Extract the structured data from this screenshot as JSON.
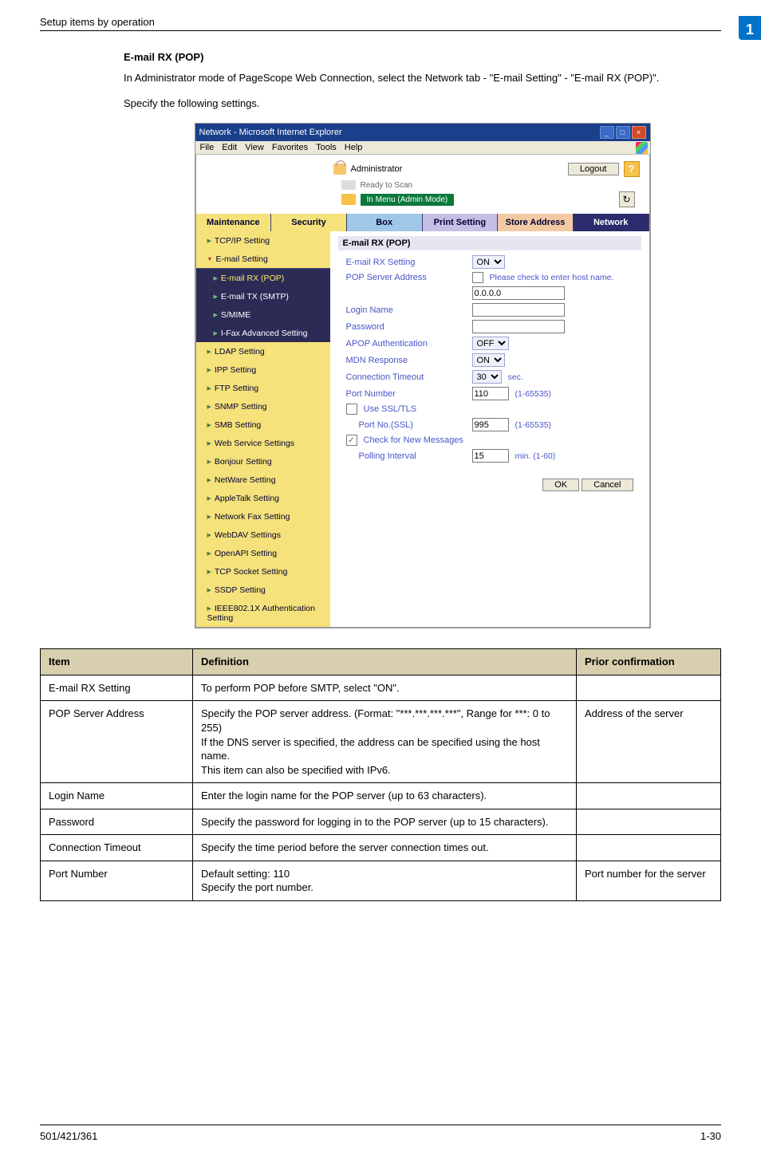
{
  "header": {
    "left": "Setup items by operation",
    "badge": "1"
  },
  "intro": {
    "title": "E-mail RX (POP)",
    "p1": "In Administrator mode of PageScope Web Connection, select the Network tab - \"E-mail Setting\" - \"E-mail RX (POP)\".",
    "p2": "Specify the following settings."
  },
  "window": {
    "title": "Network - Microsoft Internet Explorer",
    "menus": [
      "File",
      "Edit",
      "View",
      "Favorites",
      "Tools",
      "Help"
    ],
    "admin": "Administrator",
    "logout": "Logout",
    "status": "Ready to Scan",
    "mode": "In Menu (Admin Mode)",
    "tabs": {
      "maintenance": "Maintenance",
      "security": "Security",
      "box": "Box",
      "print": "Print Setting",
      "store": "Store Address",
      "network": "Network"
    }
  },
  "sidebar": {
    "tcpip": "TCP/IP Setting",
    "email": "E-mail Setting",
    "emailrx": "E-mail RX (POP)",
    "emailtx": "E-mail TX (SMTP)",
    "smime": "S/MIME",
    "ifax": "I-Fax Advanced Setting",
    "ldap": "LDAP Setting",
    "ipp": "IPP Setting",
    "ftp": "FTP Setting",
    "snmp": "SNMP Setting",
    "smb": "SMB Setting",
    "web": "Web Service Settings",
    "bonjour": "Bonjour Setting",
    "netware": "NetWare Setting",
    "apple": "AppleTalk Setting",
    "netfax": "Network Fax Setting",
    "webdav": "WebDAV Settings",
    "openapi": "OpenAPI Setting",
    "tcpsock": "TCP Socket Setting",
    "ssdp": "SSDP Setting",
    "ieee": "IEEE802.1X Authentication Setting"
  },
  "form": {
    "title": "E-mail RX (POP)",
    "rx_label": "E-mail RX Setting",
    "rx_val": "ON",
    "pop_label": "POP Server Address",
    "pop_hostchk": "Please check to enter host name.",
    "pop_val": "0.0.0.0",
    "login_label": "Login Name",
    "pass_label": "Password",
    "apop_label": "APOP Authentication",
    "apop_val": "OFF",
    "mdn_label": "MDN Response",
    "mdn_val": "ON",
    "conn_label": "Connection Timeout",
    "conn_val": "30",
    "conn_unit": "sec.",
    "port_label": "Port Number",
    "port_val": "110",
    "port_range": "(1-65535)",
    "ssl_label": "Use SSL/TLS",
    "sslport_label": "Port No.(SSL)",
    "sslport_val": "995",
    "sslport_range": "(1-65535)",
    "chk_label": "Check for New Messages",
    "poll_label": "Polling Interval",
    "poll_val": "15",
    "poll_unit": "min.  (1-60)",
    "ok": "OK",
    "cancel": "Cancel"
  },
  "table": {
    "h1": "Item",
    "h2": "Definition",
    "h3": "Prior confirmation",
    "rows": [
      {
        "item": "E-mail RX Setting",
        "def": "To perform POP before SMTP, select \"ON\".",
        "prior": ""
      },
      {
        "item": "POP Server Address",
        "def": "Specify the POP server address. (Format: \"***.***.***.***\", Range for ***: 0 to 255)\nIf the DNS server is specified, the address can be specified using the host name.\nThis item can also be specified with IPv6.",
        "prior": "Address of the server"
      },
      {
        "item": "Login Name",
        "def": "Enter the login name for the POP server (up to 63 characters).",
        "prior": ""
      },
      {
        "item": "Password",
        "def": "Specify the password for logging in to the POP server (up to 15 characters).",
        "prior": ""
      },
      {
        "item": "Connection Timeout",
        "def": "Specify the time period before the server connection times out.",
        "prior": ""
      },
      {
        "item": "Port Number",
        "def": "Default setting: 110\nSpecify the port number.",
        "prior": "Port number for the server"
      }
    ]
  },
  "footer": {
    "left": "501/421/361",
    "right": "1-30"
  }
}
